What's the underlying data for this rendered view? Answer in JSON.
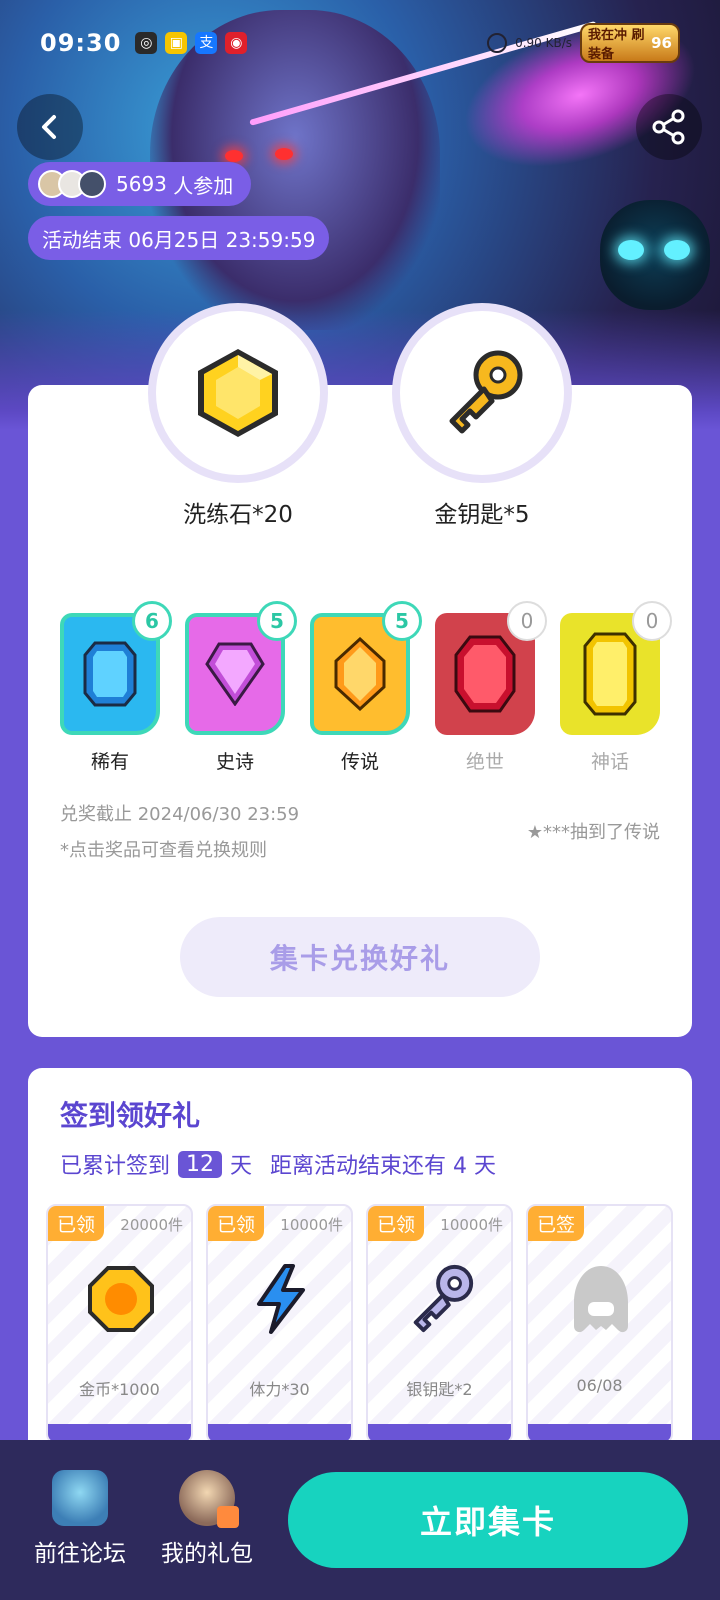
{
  "status_bar": {
    "time": "09:30",
    "network": "0.90 KB/s",
    "game_badge": {
      "title": "我在冲 刷装备",
      "level": "96"
    }
  },
  "event": {
    "participants_count": "5693",
    "participants_text": "人参加",
    "end_text": "活动结束 06月25日 23:59:59"
  },
  "prizes": [
    {
      "name": "洗练石*20",
      "icon": "hexagon-gem-icon"
    },
    {
      "name": "金钥匙*5",
      "icon": "golden-key-icon"
    }
  ],
  "gems": [
    {
      "label": "稀有",
      "count": "6",
      "owned": true,
      "color": "#2bb8f0"
    },
    {
      "label": "史诗",
      "count": "5",
      "owned": true,
      "color": "#e66ae8"
    },
    {
      "label": "传说",
      "count": "5",
      "owned": true,
      "color": "#ffbd2e"
    },
    {
      "label": "绝世",
      "count": "0",
      "owned": false,
      "color": "#d1424c"
    },
    {
      "label": "神话",
      "count": "0",
      "owned": false,
      "color": "#e9e32a"
    }
  ],
  "exchange": {
    "deadline": "兑奖截止 2024/06/30 23:59",
    "hint": "*点击奖品可查看兑换规则",
    "ticker": "★***抽到了传说",
    "button": "集卡兑换好礼"
  },
  "signin": {
    "title": "签到领好礼",
    "text_prefix": "已累计签到",
    "days": "12",
    "text_days_unit": "天",
    "text_remaining": "距离活动结束还有 4 天",
    "items": [
      {
        "tag": "已领",
        "qty": "20000件",
        "label": "金币*1000",
        "icon": "gold-coin-icon"
      },
      {
        "tag": "已领",
        "qty": "10000件",
        "label": "体力*30",
        "icon": "lightning-icon"
      },
      {
        "tag": "已领",
        "qty": "10000件",
        "label": "银钥匙*2",
        "icon": "silver-key-icon"
      },
      {
        "tag": "已签",
        "qty": "",
        "label": "06/08",
        "icon": "hooded-character-icon"
      }
    ]
  },
  "bottom_bar": {
    "forum": "前往论坛",
    "gifts": "我的礼包",
    "collect_button": "立即集卡"
  }
}
